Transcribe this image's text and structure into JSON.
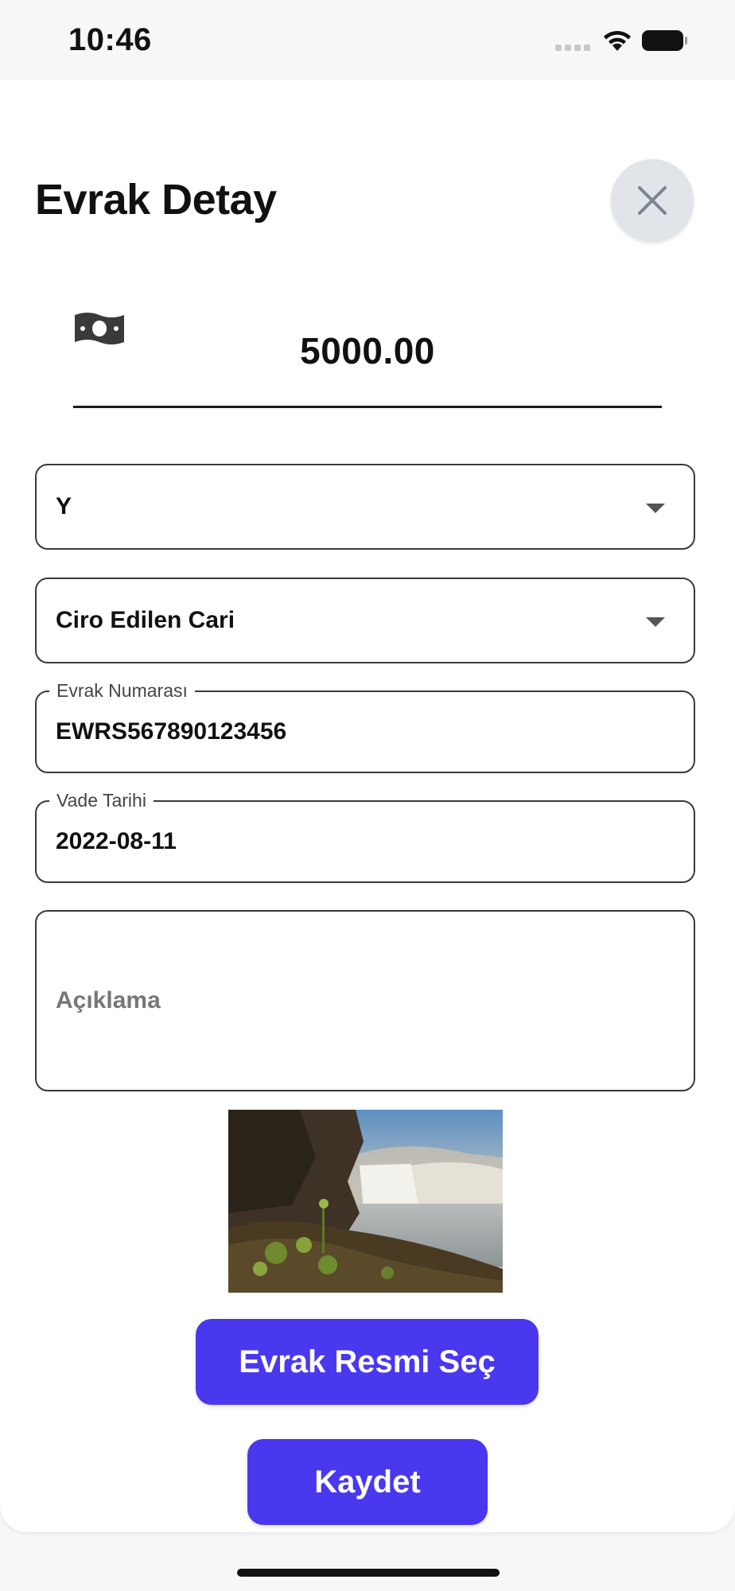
{
  "status_bar": {
    "time": "10:46",
    "wifi_icon": "wifi-icon",
    "battery_icon": "battery-icon"
  },
  "sheet": {
    "title": "Evrak Detay",
    "close_icon": "close-icon"
  },
  "amount": {
    "icon": "money-icon",
    "value": "5000.00"
  },
  "type_select": {
    "value": "Y"
  },
  "account_select": {
    "value": "Ciro Edilen Cari"
  },
  "document_number": {
    "label": "Evrak Numarası",
    "value": "EWRS567890123456"
  },
  "due_date": {
    "label": "Vade Tarihi",
    "value": "2022-08-11"
  },
  "description": {
    "placeholder": "Açıklama"
  },
  "image_preview": {
    "alt": "waterfall-photo"
  },
  "buttons": {
    "select_image": "Evrak Resmi Seç",
    "save": "Kaydet"
  },
  "colors": {
    "primary": "#4a38ee",
    "close_bg": "#e1e5ea"
  }
}
